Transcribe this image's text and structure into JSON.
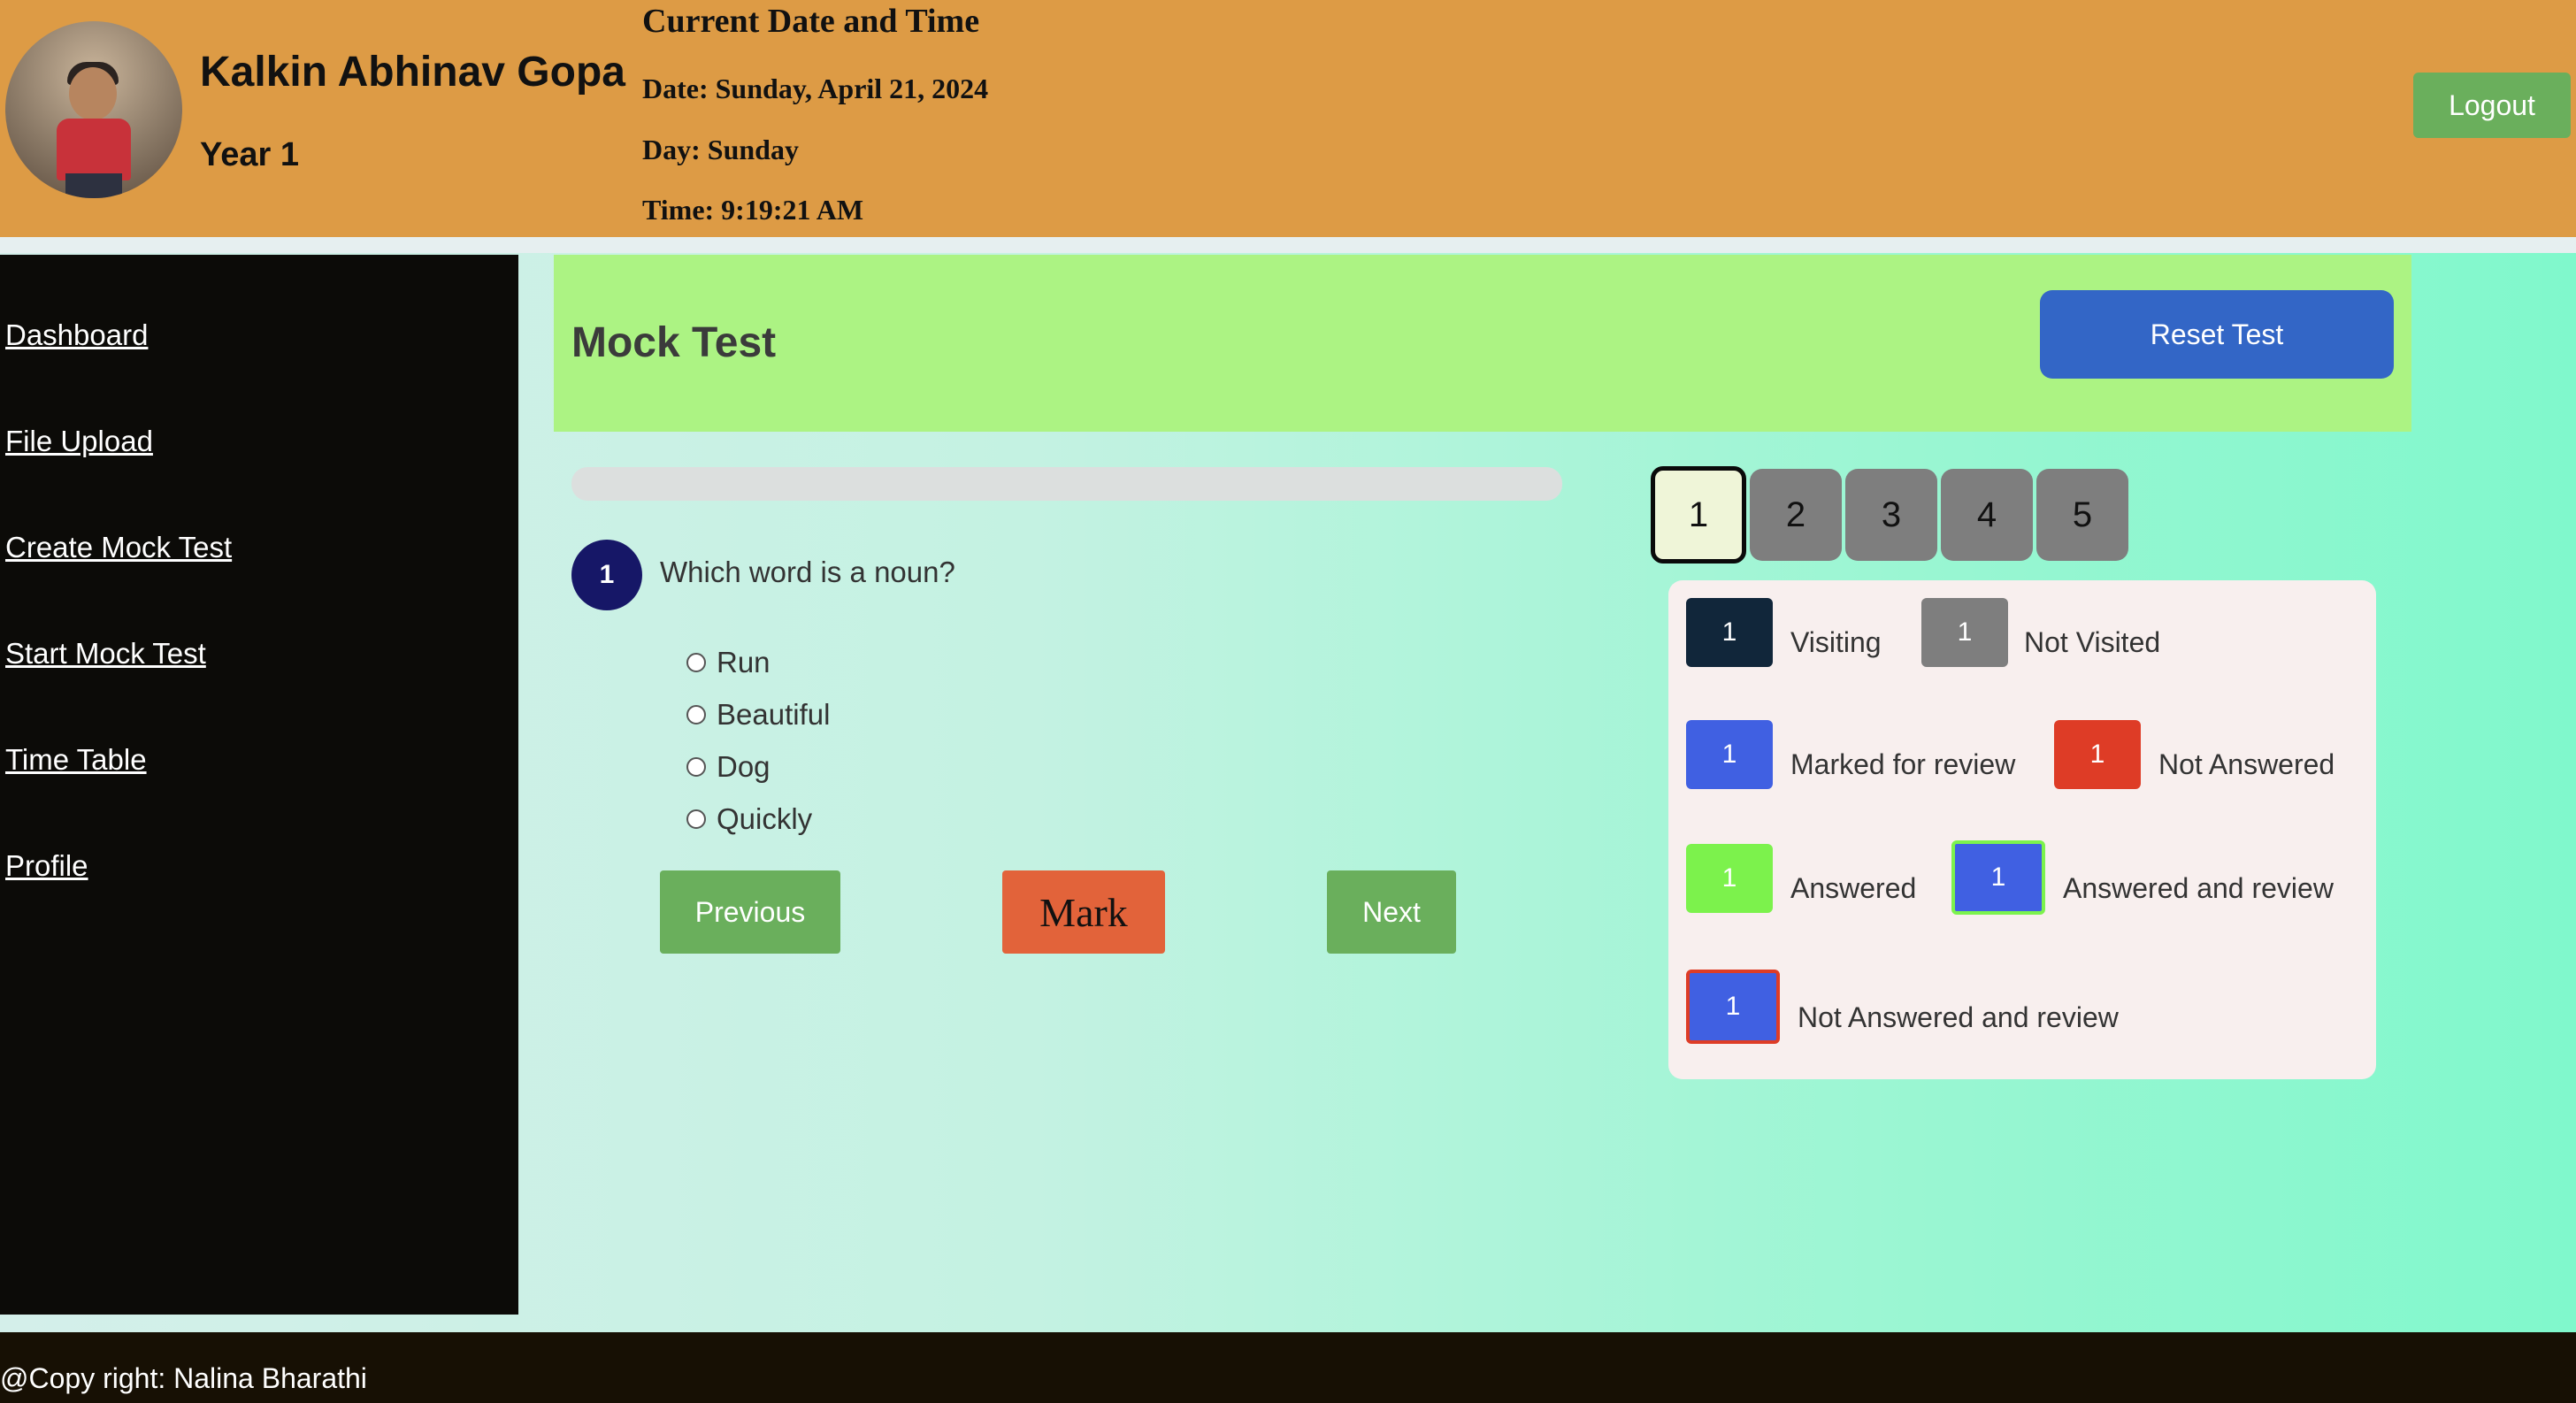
{
  "header": {
    "user_name": "Kalkin Abhinav Gopa",
    "year": "Year 1",
    "datetime_title": "Current Date and Time",
    "date": "Date: Sunday, April 21, 2024",
    "day": "Day: Sunday",
    "time": "Time: 9:19:21 AM",
    "logout_label": "Logout",
    "avatar_icon": "child-photo-avatar"
  },
  "sidebar": {
    "items": [
      {
        "label": "Dashboard"
      },
      {
        "label": "File Upload"
      },
      {
        "label": "Create Mock Test"
      },
      {
        "label": "Start Mock Test"
      },
      {
        "label": "Time Table"
      },
      {
        "label": "Profile"
      }
    ]
  },
  "main": {
    "title": "Mock Test",
    "reset_label": "Reset Test",
    "progress_fraction": 0,
    "question": {
      "number": "1",
      "text": "Which word is a noun?",
      "options": [
        "Run",
        "Beautiful",
        "Dog",
        "Quickly"
      ]
    },
    "buttons": {
      "previous": "Previous",
      "mark": "Mark",
      "next": "Next"
    }
  },
  "palette": {
    "questions": [
      "1",
      "2",
      "3",
      "4",
      "5"
    ],
    "active_index": 0
  },
  "legend": {
    "swatch_number": "1",
    "items": [
      {
        "label": "Visiting",
        "color": "#11263a"
      },
      {
        "label": "Not Visited",
        "color": "#7e7e7e"
      },
      {
        "label": "Marked for review",
        "color": "#4060e2"
      },
      {
        "label": "Not Answered",
        "color": "#de3c26"
      },
      {
        "label": "Answered",
        "color": "#7cf24c"
      },
      {
        "label": "Answered and review",
        "color": "#4060e2",
        "border": "#7cf24c"
      },
      {
        "label": "Not Answered and review",
        "color": "#4060e2",
        "border": "#de3c26"
      }
    ]
  },
  "colors": {
    "header_bg": "#dd9b45",
    "sidebar_bg": "#0c0b08",
    "title_card_bg": "#acf383",
    "reset_button": "#3366c6",
    "nav_button": "#6aaf5c",
    "mark_button": "#e2633a",
    "question_badge": "#161767"
  },
  "footer": {
    "text": "@Copy right: Nalina Bharathi"
  }
}
